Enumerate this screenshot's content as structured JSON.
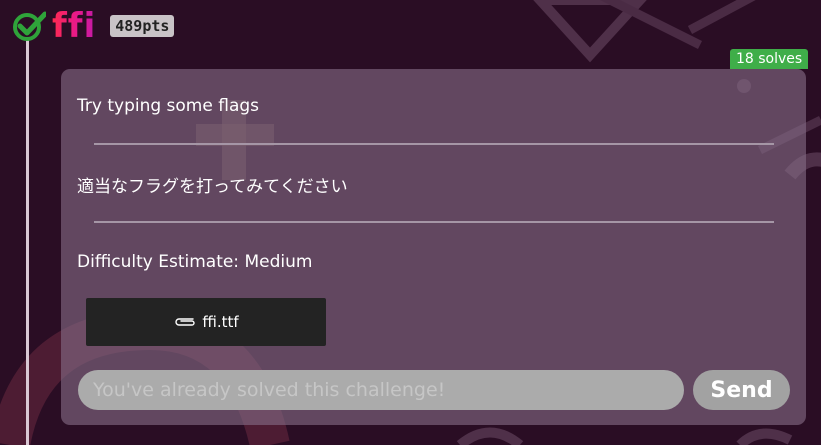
{
  "challenge": {
    "title": "ffi",
    "points": "489pts",
    "solves": "18 solves",
    "solved": true,
    "description": {
      "english": "Try typing some flags",
      "japanese": "適当なフラグを打ってみてください",
      "difficulty": "Difficulty Estimate: Medium"
    },
    "attachment": {
      "icon": "paperclip-icon",
      "filename": "ffi.ttf"
    },
    "flag_input": {
      "placeholder": "You've already solved this challenge!",
      "value": ""
    },
    "send_label": "Send"
  },
  "colors": {
    "background": "#2a0d24",
    "check": "#2fa33a",
    "title_gradient_start": "#ff2a4f",
    "title_gradient_end": "#c21aa8",
    "solves_badge": "#3fae49",
    "card": "#846c86"
  }
}
